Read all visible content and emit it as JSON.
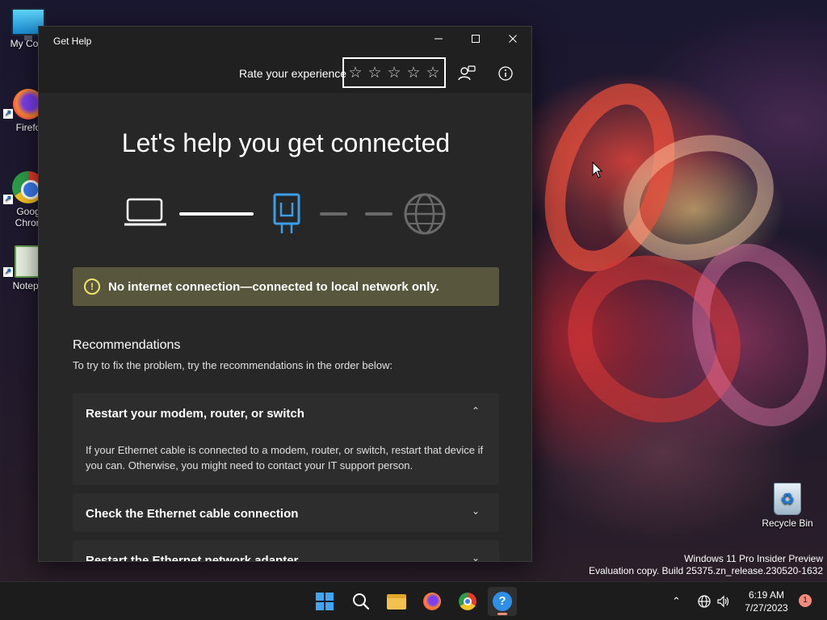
{
  "desktop": {
    "icons": [
      {
        "label": "My Com",
        "icon": "this-pc-icon"
      },
      {
        "label": "Firefo",
        "icon": "firefox-icon"
      },
      {
        "label": "Goog\nChron",
        "icon": "chrome-icon"
      },
      {
        "label": "Notepa",
        "icon": "notepad-icon"
      },
      {
        "label": "Recycle Bin",
        "icon": "recycle-bin-icon"
      }
    ]
  },
  "window": {
    "title": "Get Help",
    "controls": {
      "minimize": "—",
      "maximize": "☐",
      "close": "✕"
    }
  },
  "toolbar": {
    "rate_label": "Rate your experience",
    "rating": {
      "max": 5,
      "selected": 0,
      "star_glyph": "☆"
    }
  },
  "main": {
    "heading": "Let's help you get connected",
    "status": {
      "icon": "!",
      "message": "No internet connection—connected to local network only.",
      "color": "#58573e"
    },
    "recommendations": {
      "title": "Recommendations",
      "subtitle": "To try to fix the problem, try the recommendations in the order below:",
      "items": [
        {
          "title": "Restart your modem, router, or switch",
          "expanded": true,
          "chevron": "⌃",
          "body": "If your Ethernet cable is connected to a modem, router, or switch, restart that device if you can. Otherwise, you might need to contact your IT support person."
        },
        {
          "title": "Check the Ethernet cable connection",
          "expanded": false,
          "chevron": "⌄"
        },
        {
          "title": "Restart the Ethernet network adapter",
          "expanded": false,
          "chevron": "⌄"
        }
      ]
    }
  },
  "watermark": {
    "line1": "Windows 11 Pro Insider Preview",
    "line2": "Evaluation copy. Build 25375.zn_release.230520-1632"
  },
  "taskbar": {
    "apps": [
      "start",
      "search",
      "file-explorer",
      "firefox",
      "chrome",
      "get-help"
    ],
    "tray": {
      "chevron": "⌃",
      "time": "6:19 AM",
      "date": "7/27/2023",
      "notifications": "1"
    },
    "accent": "#f28b7a"
  },
  "colors": {
    "accent_blue": "#2d8fe6",
    "diagram_active": "#3a9ee8",
    "diagram_inactive": "#6a6a6a"
  }
}
